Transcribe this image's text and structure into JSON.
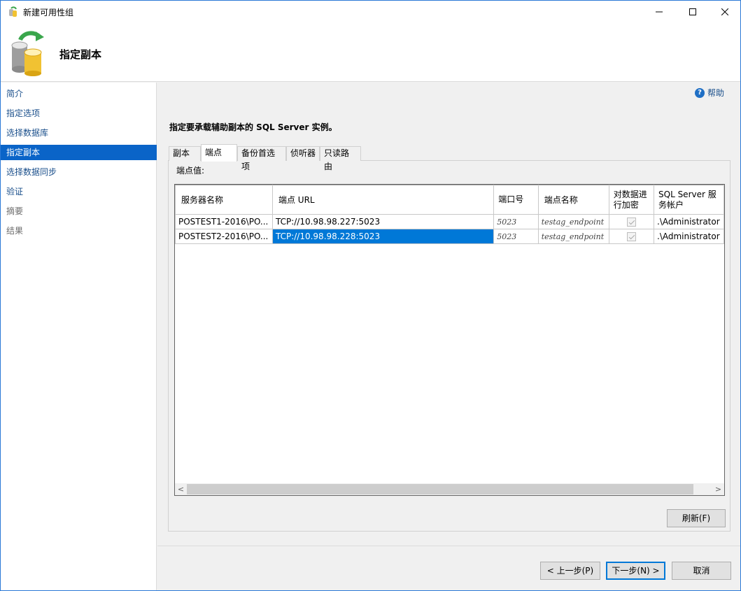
{
  "window": {
    "title": "新建可用性组"
  },
  "header": {
    "title": "指定副本"
  },
  "nav": {
    "items": [
      {
        "label": "简介"
      },
      {
        "label": "指定选项"
      },
      {
        "label": "选择数据库"
      },
      {
        "label": "指定副本"
      },
      {
        "label": "选择数据同步"
      },
      {
        "label": "验证"
      },
      {
        "label": "摘要"
      },
      {
        "label": "结果"
      }
    ]
  },
  "help": {
    "label": "帮助"
  },
  "main": {
    "instruction": "指定要承载辅助副本的 SQL Server 实例。",
    "tabs": [
      {
        "label": "副本"
      },
      {
        "label": "端点"
      },
      {
        "label": "备份首选项"
      },
      {
        "label": "侦听器"
      },
      {
        "label": "只读路由"
      }
    ],
    "panel_label": "端点值:"
  },
  "grid": {
    "columns": [
      "服务器名称",
      "端点 URL",
      "端口号",
      "端点名称",
      "对数据进行加密",
      "SQL Server 服务帐户"
    ],
    "rows": [
      {
        "server": "POSTEST1-2016\\PO...",
        "url": "TCP://10.98.98.227:5023",
        "port": "5023",
        "endpoint": "testag_endpoint",
        "encrypt": true,
        "account": ".\\Administrator"
      },
      {
        "server": "POSTEST2-2016\\PO...",
        "url": "TCP://10.98.98.228:5023",
        "port": "5023",
        "endpoint": "testag_endpoint",
        "encrypt": true,
        "account": ".\\Administrator"
      }
    ]
  },
  "buttons": {
    "refresh": "刷新(F)",
    "prev": "< 上一步(P)",
    "next": "下一步(N) >",
    "cancel": "取消"
  },
  "colors": {
    "accent": "#0078d7",
    "nav_selected": "#0a64c8"
  }
}
